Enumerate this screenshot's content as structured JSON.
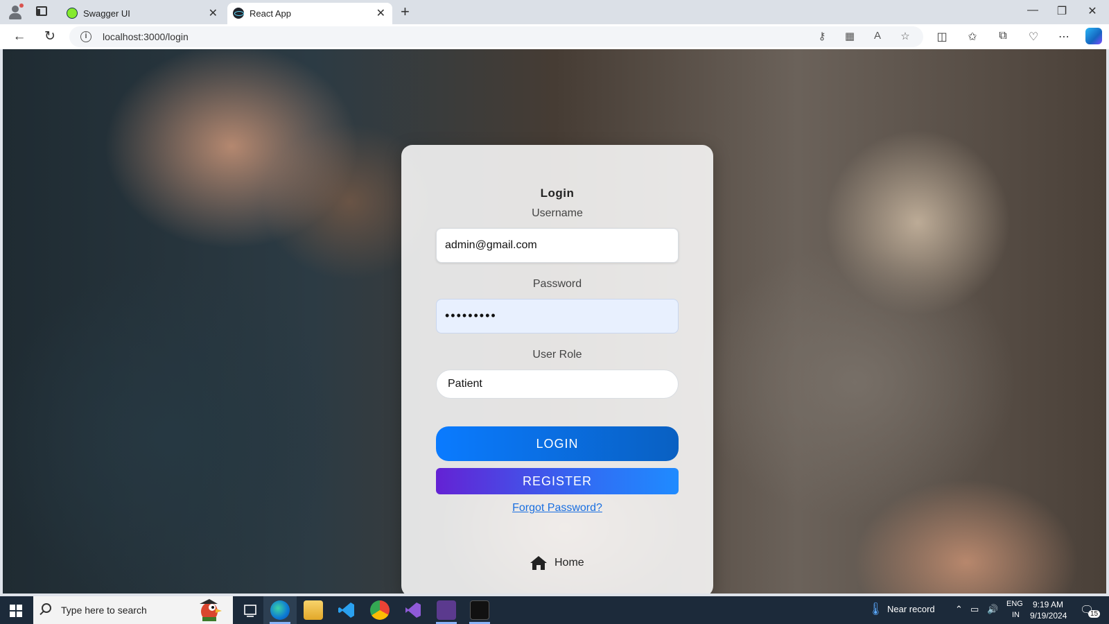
{
  "browser": {
    "tabs": [
      {
        "title": "Swagger UI",
        "active": false,
        "icon": "swagger-favicon"
      },
      {
        "title": "React App",
        "active": true,
        "icon": "react-favicon"
      }
    ],
    "new_tab": "+",
    "url": "localhost:3000/login",
    "window_controls": {
      "minimize": "—",
      "maximize": "❐",
      "close": "✕"
    }
  },
  "login": {
    "title": "Login",
    "username_label": "Username",
    "username_value": "admin@gmail.com",
    "password_label": "Password",
    "password_value": "•••••••••",
    "role_label": "User Role",
    "role_value": "Patient",
    "login_button": "LOGIN",
    "register_button": "REGISTER",
    "forgot_link": "Forgot Password?",
    "home_label": "Home"
  },
  "taskbar": {
    "search_placeholder": "Type here to search",
    "weather": "Near record",
    "language": "ENG",
    "region": "IN",
    "time": "9:19 AM",
    "date": "9/19/2024",
    "notifications": "15"
  },
  "colors": {
    "login_button": "#0a7bff",
    "register_button": "#6422d4",
    "link": "#1a6fe0",
    "taskbar": "#1c2a3a"
  }
}
